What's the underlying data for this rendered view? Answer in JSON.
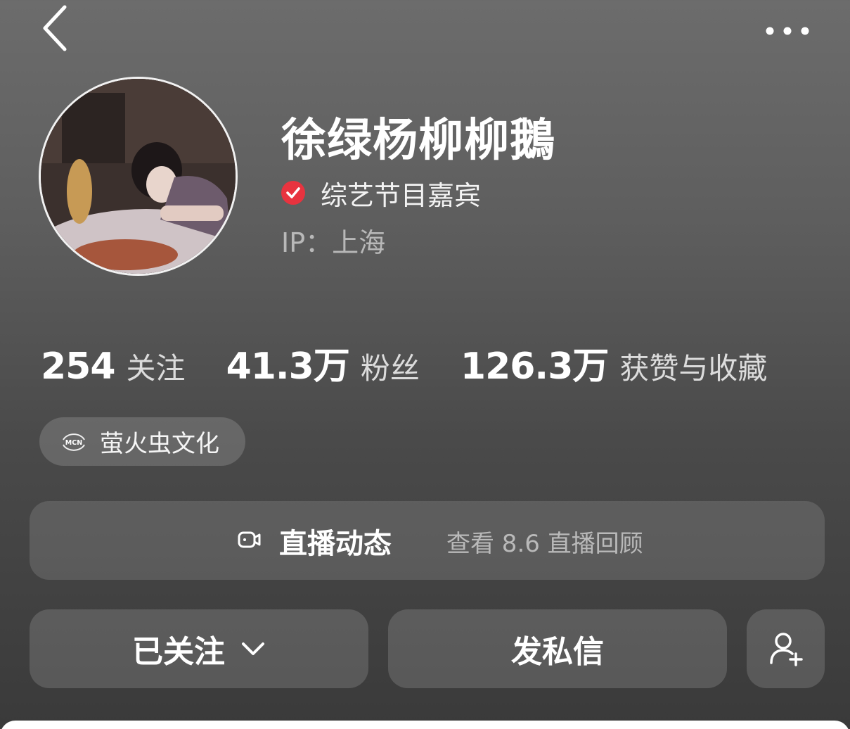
{
  "header": {
    "back_icon": "chevron-left-icon",
    "more_icon": "more-horizontal-icon"
  },
  "profile": {
    "name": "徐绿杨柳柳鵝",
    "verified_label": "综艺节目嘉宾",
    "ip_label": "IP：上海",
    "verify_color": "#e8333f"
  },
  "stats": [
    {
      "value": "254",
      "label": "关注"
    },
    {
      "value": "41.3万",
      "label": "粉丝"
    },
    {
      "value": "126.3万",
      "label": "获赞与收藏"
    }
  ],
  "mcn": {
    "badge": "MCN",
    "name": "萤火虫文化"
  },
  "live": {
    "title": "直播动态",
    "subtitle": "查看 8.6 直播回顾"
  },
  "actions": {
    "follow_label": "已关注",
    "message_label": "发私信",
    "add_friend_icon": "add-user-icon"
  }
}
